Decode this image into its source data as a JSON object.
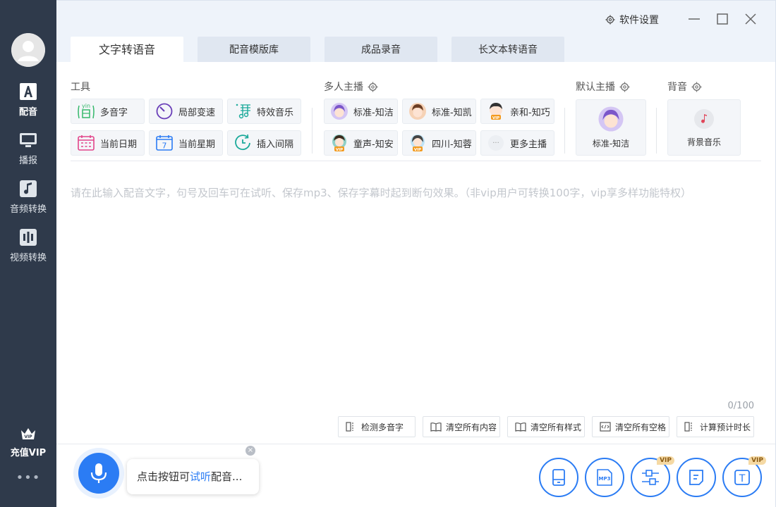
{
  "sidebar": {
    "items": [
      {
        "label": "配音",
        "icon": "letter-a-icon"
      },
      {
        "label": "播报",
        "icon": "monitor-icon"
      },
      {
        "label": "音频转换",
        "icon": "music-note-icon"
      },
      {
        "label": "视频转换",
        "icon": "video-bars-icon"
      }
    ],
    "vip_label": "充值VIP",
    "vip_badge": "VIP",
    "more": "•••"
  },
  "header": {
    "settings_label": "软件设置"
  },
  "tabs": [
    {
      "label": "文字转语音"
    },
    {
      "label": "配音模版库"
    },
    {
      "label": "成品录音"
    },
    {
      "label": "长文本转语音"
    }
  ],
  "tools": {
    "label": "工具",
    "items": [
      {
        "label": "多音字",
        "icon": "yin-icon",
        "icon_text": "yin"
      },
      {
        "label": "局部变速",
        "icon": "speed-icon"
      },
      {
        "label": "特效音乐",
        "icon": "music-staff-icon"
      },
      {
        "label": "当前日期",
        "icon": "calendar-grid-icon"
      },
      {
        "label": "当前星期",
        "icon": "calendar-icon",
        "icon_text": "7"
      },
      {
        "label": "插入间隔",
        "icon": "clock-icon"
      }
    ]
  },
  "multi_anchor": {
    "label": "多人主播",
    "items": [
      {
        "label": "标准-知洁",
        "vip": false
      },
      {
        "label": "标准-知凯",
        "vip": false
      },
      {
        "label": "亲和-知巧",
        "vip": true
      },
      {
        "label": "童声-知安",
        "vip": true
      },
      {
        "label": "四川-知蓉",
        "vip": true
      },
      {
        "label": "更多主播",
        "vip": false
      }
    ],
    "vip_text": "VIP",
    "more_icon_text": "···"
  },
  "default_anchor": {
    "label": "默认主播",
    "name": "标准-知洁"
  },
  "bgm": {
    "label": "背音",
    "name": "背景音乐"
  },
  "editor": {
    "placeholder": "请在此输入配音文字，句号及回车可在试听、保存mp3、保存字幕时起到断句效果。（非vip用户可转换100字，vip享多样功能特权）",
    "counter": "0/100"
  },
  "tool_buttons": [
    {
      "label": "检测多音字"
    },
    {
      "label": "清空所有内容"
    },
    {
      "label": "清空所有样式"
    },
    {
      "label": "清空所有空格"
    },
    {
      "label": "计算预计时长"
    }
  ],
  "bottom": {
    "hint_prefix": "点击按钮可",
    "hint_highlight": "试听",
    "hint_suffix": "配音...",
    "close": "×",
    "mp3_label": "MP3",
    "t_label": "T",
    "vip_tag": "VIP"
  },
  "colors": {
    "accent": "#2b7cf4",
    "sidebar": "#2f3a4b"
  }
}
